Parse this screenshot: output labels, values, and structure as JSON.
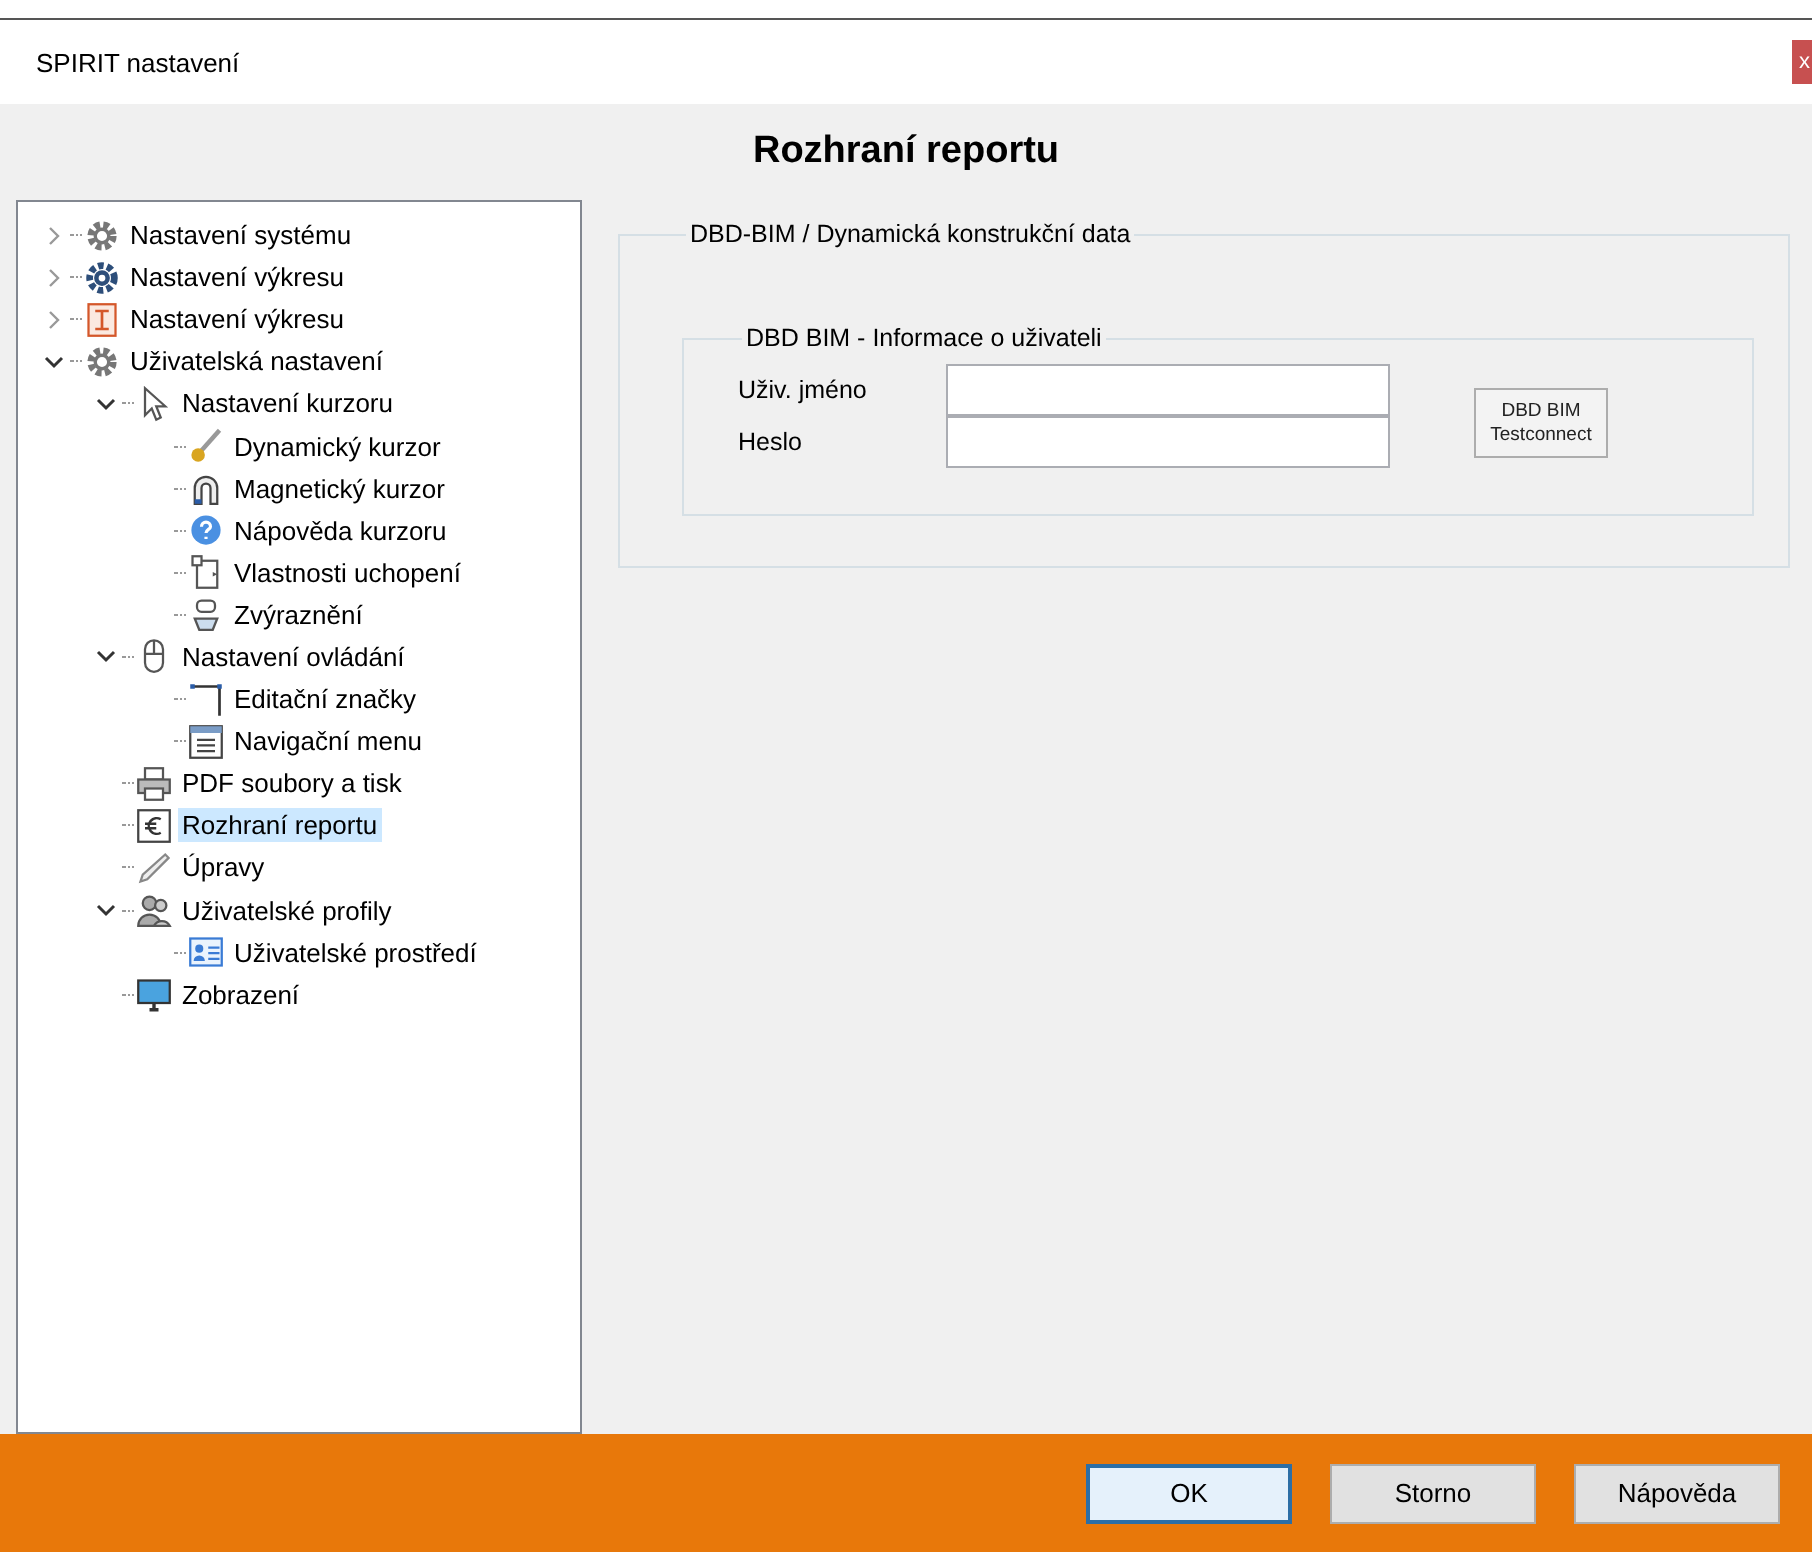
{
  "window": {
    "title": "SPIRIT nastavení",
    "close": "x"
  },
  "header": {
    "title": "Rozhraní reportu"
  },
  "tree": [
    {
      "label": "Nastavení systému",
      "expanded": false,
      "selected": false
    },
    {
      "label": "Nastavení výkresu",
      "expanded": false,
      "selected": false
    },
    {
      "label": "Nastavení výkresu",
      "expanded": false,
      "selected": false
    },
    {
      "label": "Uživatelská nastavení",
      "expanded": true,
      "selected": false,
      "children": [
        {
          "label": "Nastavení kurzoru",
          "expanded": true,
          "selected": false,
          "children": [
            {
              "label": "Dynamický kurzor",
              "selected": false
            },
            {
              "label": "Magnetický kurzor",
              "selected": false
            },
            {
              "label": "Nápověda kurzoru",
              "selected": false
            },
            {
              "label": "Vlastnosti uchopení",
              "selected": false
            },
            {
              "label": "Zvýraznění",
              "selected": false
            }
          ]
        },
        {
          "label": "Nastavení ovládání",
          "expanded": true,
          "selected": false,
          "children": [
            {
              "label": "Editační značky",
              "selected": false
            },
            {
              "label": "Navigační menu",
              "selected": false
            }
          ]
        },
        {
          "label": "PDF soubory a tisk",
          "selected": false
        },
        {
          "label": "Rozhraní reportu",
          "selected": true
        },
        {
          "label": "Úpravy",
          "selected": false
        },
        {
          "label": "Uživatelské profily",
          "expanded": true,
          "selected": false,
          "children": [
            {
              "label": "Uživatelské prostředí",
              "selected": false
            }
          ]
        },
        {
          "label": "Zobrazení",
          "selected": false
        }
      ]
    }
  ],
  "group": {
    "title": "DBD-BIM / Dynamická konstrukční data",
    "subgroup": {
      "title": "DBD BIM - Informace o uživateli",
      "fields": [
        {
          "label": "Uživ. jméno"
        },
        {
          "label": "Heslo"
        }
      ],
      "button": "DBD BIM\nTestconnect"
    }
  },
  "buttons": [
    {
      "label": "OK",
      "default": true
    },
    {
      "label": "Storno",
      "default": false
    },
    {
      "label": "Nápověda",
      "default": false
    }
  ]
}
